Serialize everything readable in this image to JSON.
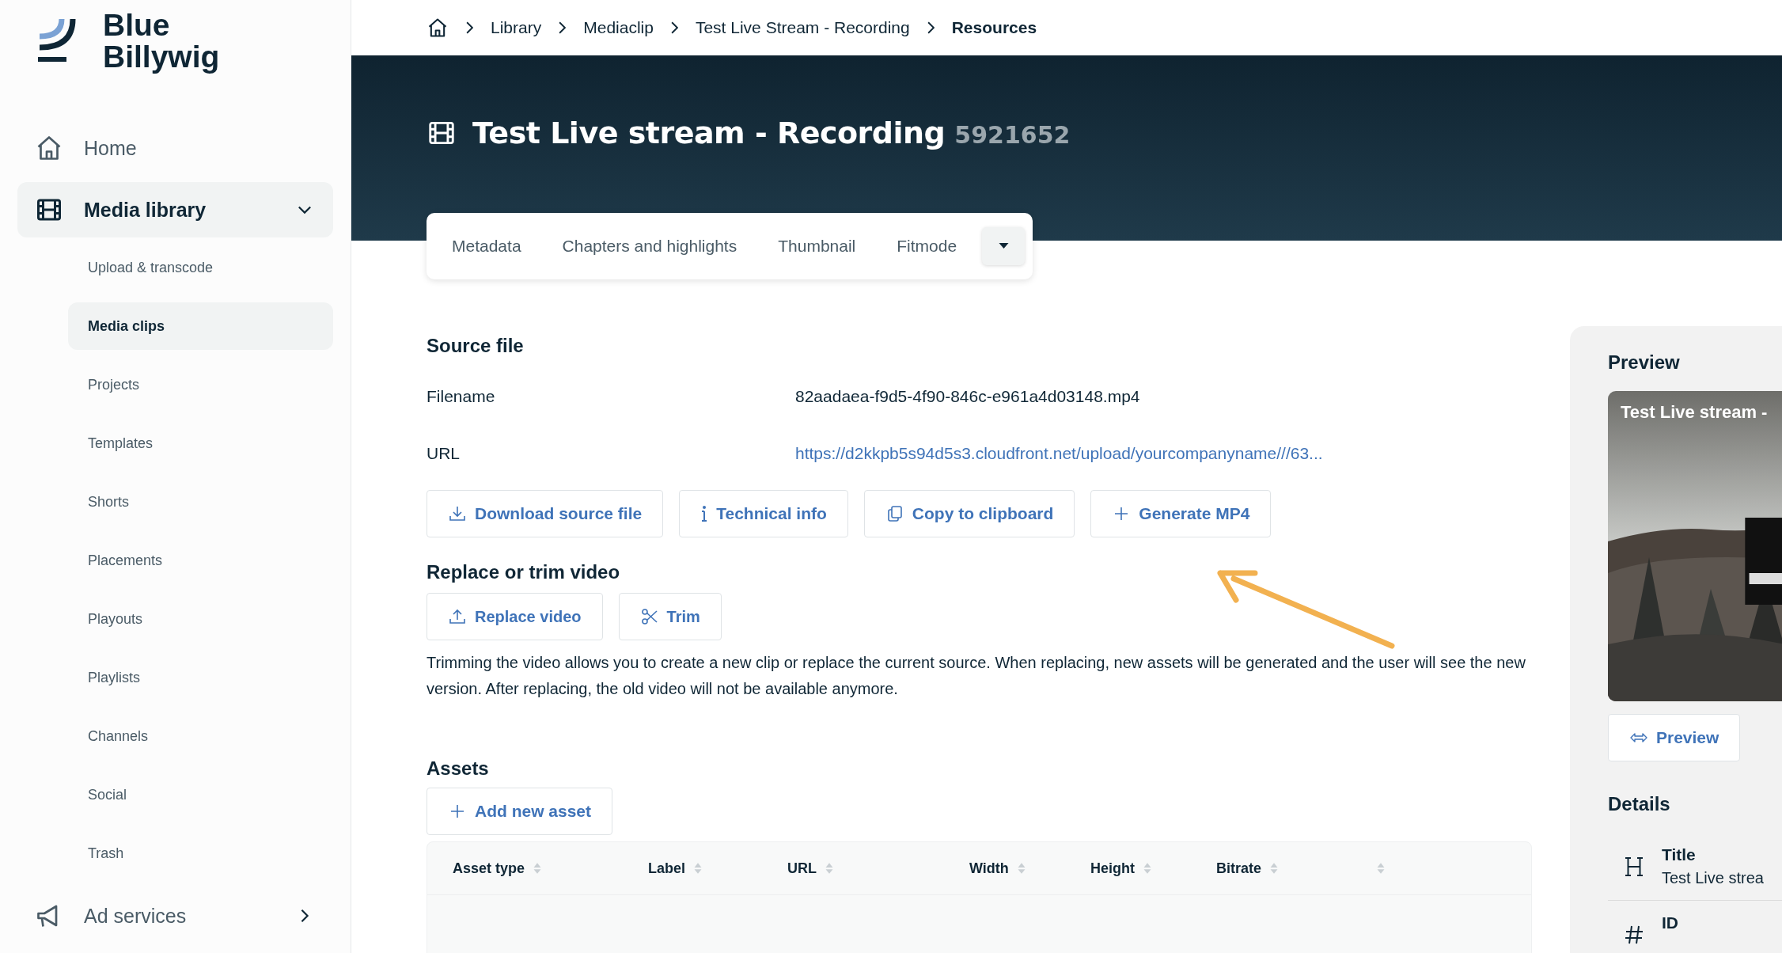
{
  "logo": {
    "line1": "Blue",
    "line2": "Billywig"
  },
  "sidebar": {
    "items": [
      {
        "label": "Home",
        "kind": "home"
      },
      {
        "label": "Media library",
        "kind": "film",
        "expanded": true,
        "children": [
          {
            "label": "Upload & transcode",
            "selected": false
          },
          {
            "label": "Media clips",
            "selected": true
          },
          {
            "label": "Projects",
            "selected": false
          },
          {
            "label": "Templates",
            "selected": false
          },
          {
            "label": "Shorts",
            "selected": false
          },
          {
            "label": "Placements",
            "selected": false
          },
          {
            "label": "Playouts",
            "selected": false
          },
          {
            "label": "Playlists",
            "selected": false
          },
          {
            "label": "Channels",
            "selected": false
          },
          {
            "label": "Social",
            "selected": false
          },
          {
            "label": "Trash",
            "selected": false
          }
        ]
      },
      {
        "label": "Ad services",
        "kind": "megaphone",
        "expanded": false
      }
    ]
  },
  "breadcrumb": [
    "Library",
    "Mediaclip",
    "Test Live Stream - Recording",
    "Resources"
  ],
  "header": {
    "title": "Test Live stream - Recording",
    "id": "5921652"
  },
  "tabs": [
    {
      "label": "Metadata",
      "selected": false
    },
    {
      "label": "Chapters and highlights",
      "selected": false
    },
    {
      "label": "Thumbnail",
      "selected": false
    },
    {
      "label": "Fitmode",
      "selected": false
    }
  ],
  "source_file": {
    "heading": "Source file",
    "fields": [
      {
        "label": "Filename",
        "value": "82aadaea-f9d5-4f90-846c-e961a4d03148.mp4",
        "kind": "text"
      },
      {
        "label": "URL",
        "value": "https://d2kkpb5s94d5s3.cloudfront.net/upload/yourcompanyname///63...",
        "kind": "link"
      }
    ],
    "buttons": [
      {
        "label": "Download source file",
        "kind": "download"
      },
      {
        "label": "Technical info",
        "kind": "info"
      },
      {
        "label": "Copy to clipboard",
        "kind": "copy"
      },
      {
        "label": "Generate MP4",
        "kind": "plus"
      }
    ]
  },
  "replace": {
    "heading": "Replace or trim video",
    "buttons": [
      {
        "label": "Replace video",
        "kind": "upload"
      },
      {
        "label": "Trim",
        "kind": "scissors"
      }
    ],
    "description": "Trimming the video allows you to create a new clip or replace the current source. When replacing, new assets will be generated and the user will see the new version. After replacing, the old video will not be available anymore."
  },
  "assets": {
    "heading": "Assets",
    "add_button": "Add new asset",
    "columns": [
      "Asset type",
      "Label",
      "URL",
      "Width",
      "Height",
      "Bitrate"
    ]
  },
  "preview": {
    "heading": "Preview",
    "picture": {
      "kind": "picture",
      "title": "Test Live stream -"
    },
    "button": "Preview"
  },
  "details": {
    "heading": "Details",
    "items": [
      {
        "label": "Title",
        "value": "Test Live strea",
        "kind": "heading"
      },
      {
        "label": "ID",
        "kind": "number"
      }
    ]
  }
}
